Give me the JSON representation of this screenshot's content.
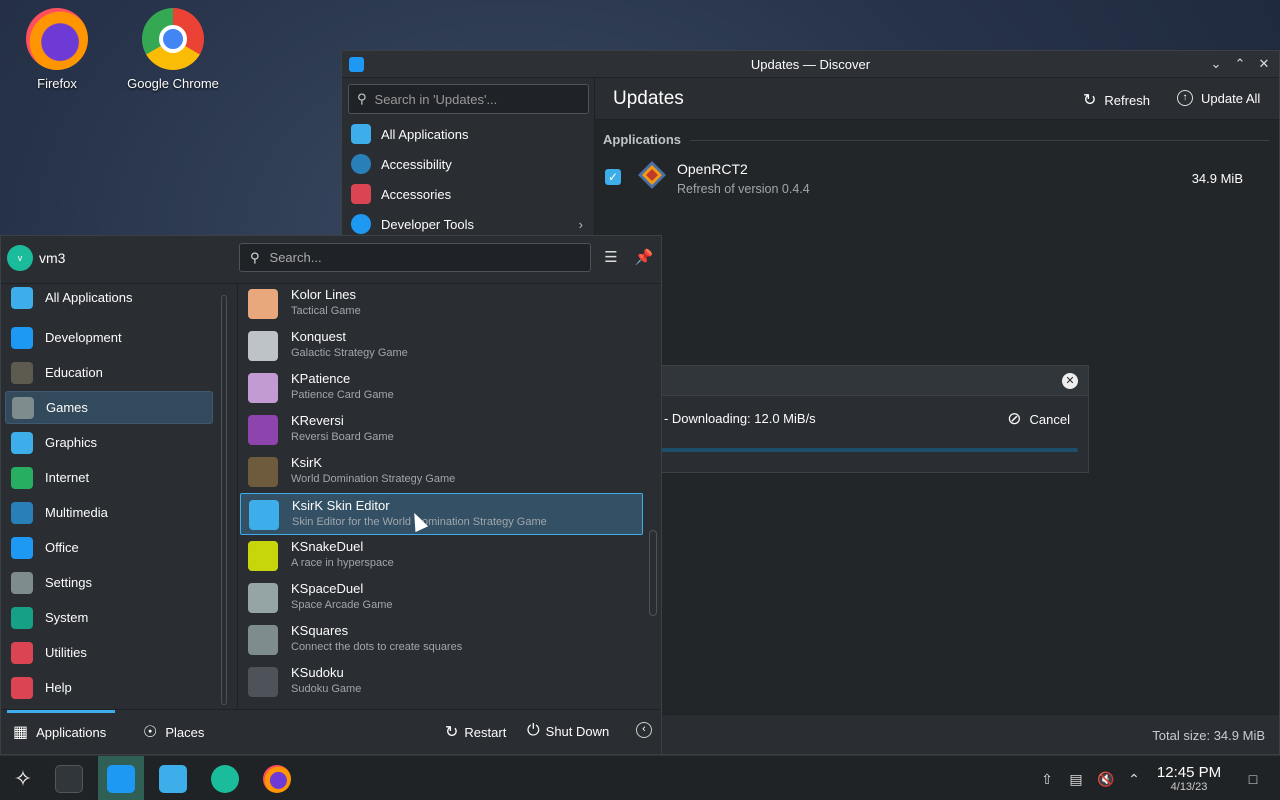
{
  "desktop": {
    "icons": [
      {
        "label": "Firefox"
      },
      {
        "label": "Google Chrome"
      }
    ]
  },
  "discover": {
    "window_title": "Updates — Discover",
    "search_placeholder": "Search in 'Updates'...",
    "categories": [
      {
        "label": "All Applications",
        "icon": "grid-icon",
        "color": "#3daee9"
      },
      {
        "label": "Accessibility",
        "icon": "accessibility-icon",
        "color": "#2980b9"
      },
      {
        "label": "Accessories",
        "icon": "toolbox-icon",
        "color": "#da4453"
      },
      {
        "label": "Developer Tools",
        "icon": "developer-icon",
        "color": "#1d99f3"
      }
    ],
    "page_title": "Updates",
    "refresh_label": "Refresh",
    "update_all_label": "Update All",
    "section_title": "Applications",
    "update": {
      "name": "OpenRCT2",
      "subtitle": "Refresh of version 0.4.4",
      "size": "34.9 MiB",
      "checked": true
    },
    "progress": {
      "message": ") - Downloading: 12.0 MiB/s",
      "cancel_label": "Cancel"
    },
    "total_size": "Total size: 34.9 MiB"
  },
  "launcher": {
    "user": {
      "avatar_letter": "v",
      "name": "vm3"
    },
    "search_placeholder": "Search...",
    "categories": [
      {
        "label": "All Applications",
        "icon": "grid-icon",
        "color": "#3daee9"
      },
      {
        "label": "Development",
        "icon": "developer-icon",
        "color": "#1d99f3"
      },
      {
        "label": "Education",
        "icon": "education-icon",
        "color": "#5d5a4f"
      },
      {
        "label": "Games",
        "icon": "gamepad-icon",
        "color": "#7f8c8d",
        "selected": true
      },
      {
        "label": "Graphics",
        "icon": "graphics-icon",
        "color": "#3daee9"
      },
      {
        "label": "Internet",
        "icon": "globe-icon",
        "color": "#27ae60"
      },
      {
        "label": "Multimedia",
        "icon": "multimedia-icon",
        "color": "#2980b9"
      },
      {
        "label": "Office",
        "icon": "office-icon",
        "color": "#1d99f3"
      },
      {
        "label": "Settings",
        "icon": "settings-icon",
        "color": "#7f8c8d"
      },
      {
        "label": "System",
        "icon": "system-icon",
        "color": "#16a085"
      },
      {
        "label": "Utilities",
        "icon": "toolbox-icon",
        "color": "#da4453"
      },
      {
        "label": "Help",
        "icon": "help-icon",
        "color": "#da4453"
      }
    ],
    "apps": [
      {
        "name": "Kolor Lines",
        "desc": "Tactical Game",
        "icon": "kolor-lines-icon",
        "color": "#e8a87c"
      },
      {
        "name": "Konquest",
        "desc": "Galactic Strategy Game",
        "icon": "konquest-icon",
        "color": "#bdc3c7"
      },
      {
        "name": "KPatience",
        "desc": "Patience Card Game",
        "icon": "cards-icon",
        "color": "#c39bd3"
      },
      {
        "name": "KReversi",
        "desc": "Reversi Board Game",
        "icon": "reversi-icon",
        "color": "#8e44ad"
      },
      {
        "name": "KsirK",
        "desc": "World Domination Strategy Game",
        "icon": "cannon-icon",
        "color": "#6e5a3c"
      },
      {
        "name": "KsirK Skin Editor",
        "desc": "Skin Editor for the World Domination Strategy Game",
        "icon": "skin-editor-icon",
        "color": "#3daee9",
        "hover": true
      },
      {
        "name": "KSnakeDuel",
        "desc": "A race in hyperspace",
        "icon": "snake-icon",
        "color": "#c7d60b"
      },
      {
        "name": "KSpaceDuel",
        "desc": "Space Arcade Game",
        "icon": "spaceship-icon",
        "color": "#95a5a6"
      },
      {
        "name": "KSquares",
        "desc": "Connect the dots to create squares",
        "icon": "squares-icon",
        "color": "#7f8c8d"
      },
      {
        "name": "KSudoku",
        "desc": "Sudoku Game",
        "icon": "sudoku-icon",
        "color": "#4d5359"
      }
    ],
    "footer": {
      "applications_label": "Applications",
      "places_label": "Places",
      "restart_label": "Restart",
      "shutdown_label": "Shut Down"
    }
  },
  "taskbar": {
    "time": "12:45 PM",
    "date": "4/13/23"
  }
}
